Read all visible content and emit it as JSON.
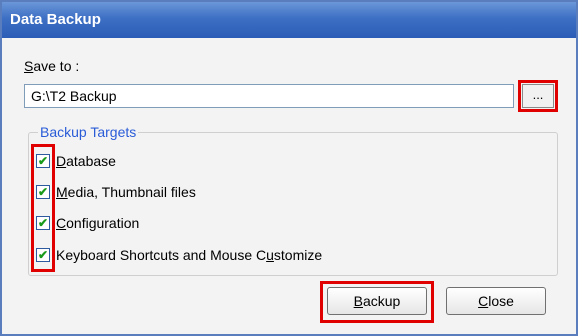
{
  "window": {
    "title": "Data Backup"
  },
  "save_to": {
    "label_prefix": "S",
    "label_rest": "ave to :",
    "value": "G:\\T2 Backup",
    "browse_label": "..."
  },
  "targets": {
    "group_title": "Backup Targets",
    "items": [
      {
        "label_prefix": "",
        "label_underlined": "D",
        "label_rest": "atabase",
        "checked": true,
        "check_glyph": "✔"
      },
      {
        "label_prefix": "",
        "label_underlined": "M",
        "label_rest": "edia, Thumbnail files",
        "checked": true,
        "check_glyph": "✔"
      },
      {
        "label_prefix": "",
        "label_underlined": "C",
        "label_rest": "onfiguration",
        "checked": true,
        "check_glyph": "✔"
      },
      {
        "label_prefix": "Keyboard Shortcuts and Mouse C",
        "label_underlined": "u",
        "label_rest": "stomize",
        "checked": true,
        "check_glyph": "✔"
      }
    ]
  },
  "buttons": {
    "backup_underlined": "B",
    "backup_rest": "ackup",
    "close_underlined": "C",
    "close_rest": "lose"
  },
  "highlight_color": "#e00000"
}
